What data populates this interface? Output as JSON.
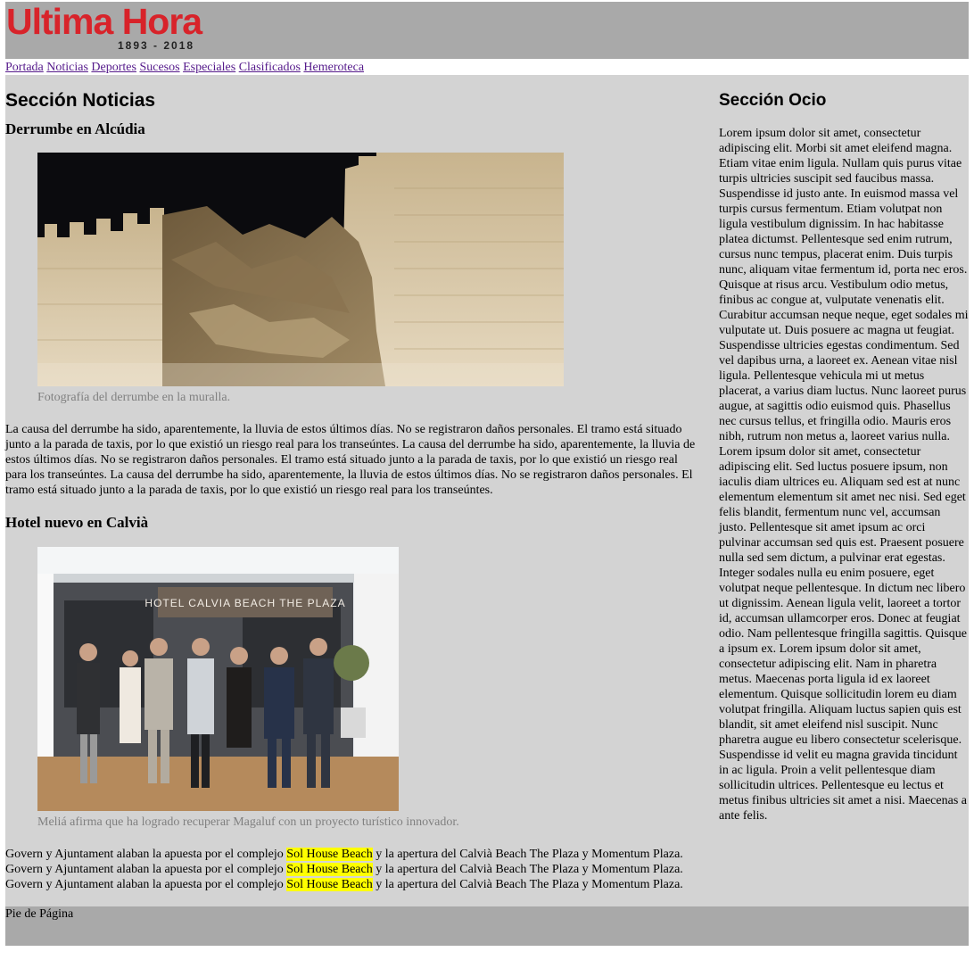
{
  "header": {
    "logo_title": "Ultima Hora",
    "logo_years": "1893 - 2018"
  },
  "nav": [
    "Portada",
    "Noticias",
    "Deportes",
    "Sucesos",
    "Especiales",
    "Clasificados",
    "Hemeroteca"
  ],
  "main": {
    "title": "Sección Noticias",
    "articles": [
      {
        "title": "Derrumbe en Alcúdia",
        "caption": "Fotografía del derrumbe en la muralla.",
        "body": "La causa del derrumbe ha sido, aparentemente, la lluvia de estos últimos días. No se registraron daños personales. El tramo está situado junto a la parada de taxis, por lo que existió un riesgo real para los transeúntes. La causa del derrumbe ha sido, aparentemente, la lluvia de estos últimos días. No se registraron daños personales. El tramo está situado junto a la parada de taxis, por lo que existió un riesgo real para los transeúntes. La causa del derrumbe ha sido, aparentemente, la lluvia de estos últimos días. No se registraron daños personales. El tramo está situado junto a la parada de taxis, por lo que existió un riesgo real para los transeúntes."
      },
      {
        "title": "Hotel nuevo en Calvià",
        "caption": "Meliá afirma que ha logrado recuperar Magaluf con un proyecto turístico innovador.",
        "image_sign": "HOTEL CALVIA BEACH THE PLAZA",
        "body_parts": [
          {
            "t": "Govern y Ajuntament alaban la apuesta por el complejo ",
            "hl": false
          },
          {
            "t": "Sol House Beach",
            "hl": true
          },
          {
            "t": " y la apertura del Calvià Beach The Plaza y Momentum Plaza. Govern y Ajuntament alaban la apuesta por el complejo ",
            "hl": false
          },
          {
            "t": "Sol House Beach",
            "hl": true
          },
          {
            "t": " y la apertura del Calvià Beach The Plaza y Momentum Plaza. Govern y Ajuntament alaban la apuesta por el complejo ",
            "hl": false
          },
          {
            "t": "Sol House Beach",
            "hl": true
          },
          {
            "t": " y la apertura del Calvià Beach The Plaza y Momentum Plaza.",
            "hl": false
          }
        ]
      }
    ]
  },
  "side": {
    "title": "Sección Ocio",
    "text": "Lorem ipsum dolor sit amet, consectetur adipiscing elit. Morbi sit amet eleifend magna. Etiam vitae enim ligula. Nullam quis purus vitae turpis ultricies suscipit sed faucibus massa. Suspendisse id justo ante. In euismod massa vel turpis cursus fermentum. Etiam volutpat non ligula vestibulum dignissim. In hac habitasse platea dictumst. Pellentesque sed enim rutrum, cursus nunc tempus, placerat enim. Duis turpis nunc, aliquam vitae fermentum id, porta nec eros. Quisque at risus arcu. Vestibulum odio metus, finibus ac congue at, vulputate venenatis elit. Curabitur accumsan neque neque, eget sodales mi vulputate ut. Duis posuere ac magna ut feugiat. Suspendisse ultricies egestas condimentum. Sed vel dapibus urna, a laoreet ex. Aenean vitae nisl ligula. Pellentesque vehicula mi ut metus placerat, a varius diam luctus. Nunc laoreet purus augue, at sagittis odio euismod quis. Phasellus nec cursus tellus, et fringilla odio. Mauris eros nibh, rutrum non metus a, laoreet varius nulla. Lorem ipsum dolor sit amet, consectetur adipiscing elit. Sed luctus posuere ipsum, non iaculis diam ultrices eu. Aliquam sed est at nunc elementum elementum sit amet nec nisi. Sed eget felis blandit, fermentum nunc vel, accumsan justo. Pellentesque sit amet ipsum ac orci pulvinar accumsan sed quis est. Praesent posuere nulla sed sem dictum, a pulvinar erat egestas. Integer sodales nulla eu enim posuere, eget volutpat neque pellentesque. In dictum nec libero ut dignissim. Aenean ligula velit, laoreet a tortor id, accumsan ullamcorper eros. Donec at feugiat odio. Nam pellentesque fringilla sagittis. Quisque a ipsum ex. Lorem ipsum dolor sit amet, consectetur adipiscing elit. Nam in pharetra metus. Maecenas porta ligula id ex laoreet elementum. Quisque sollicitudin lorem eu diam volutpat fringilla. Aliquam luctus sapien quis est blandit, sit amet eleifend nisl suscipit. Nunc pharetra augue eu libero consectetur scelerisque. Suspendisse id velit eu magna gravida tincidunt in ac ligula. Proin a velit pellentesque diam sollicitudin ultrices. Pellentesque eu lectus et metus finibus ultricies sit amet a nisi. Maecenas a ante felis."
  },
  "footer": {
    "text": "Pie de Página"
  },
  "colors": {
    "header_bg": "#a9a9a9",
    "content_bg": "#d3d3d3",
    "logo_red": "#d8232a",
    "link": "#551a8b",
    "caption": "#808080",
    "highlight": "#ffff00"
  }
}
